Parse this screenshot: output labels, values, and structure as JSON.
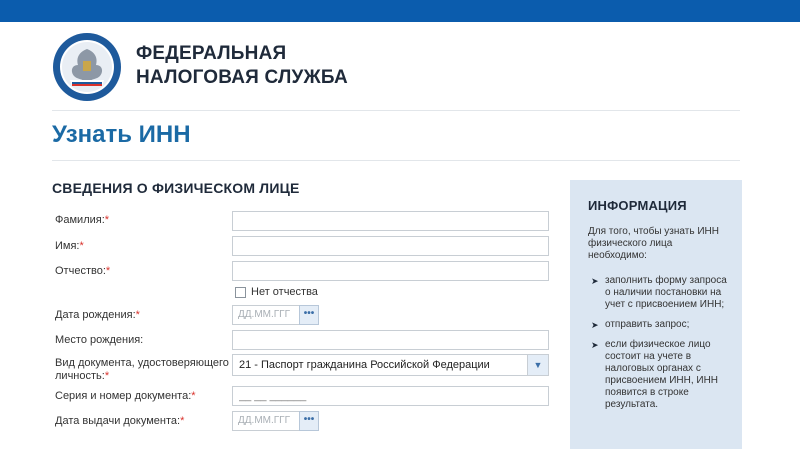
{
  "header": {
    "org_line1": "ФЕДЕРАЛЬНАЯ",
    "org_line2": "НАЛОГОВАЯ СЛУЖБА",
    "emblem_text": "ФЕДЕРАЛЬНАЯ НАЛОГОВАЯ СЛУЖБА",
    "topbar_color": "#0b5cad"
  },
  "page": {
    "title": "Узнать ИНН",
    "title_color": "#1b6aa5"
  },
  "form": {
    "section_title": "СВЕДЕНИЯ О ФИЗИЧЕСКОМ ЛИЦЕ",
    "required_mark": "*",
    "required_color": "#d9312b",
    "fields": {
      "surname": {
        "label": "Фамилия:",
        "value": ""
      },
      "name": {
        "label": "Имя:",
        "value": ""
      },
      "patronymic": {
        "label": "Отчество:",
        "value": ""
      },
      "no_patronymic": {
        "label": "Нет отчества",
        "checked": false
      },
      "birth_date": {
        "label": "Дата рождения:",
        "placeholder": "ДД.ММ.ГГГ",
        "button": "•••"
      },
      "birth_place": {
        "label": "Место рождения:",
        "value": ""
      },
      "doc_type": {
        "label_line1": "Вид документа, удостоверяющего",
        "label_line2": "личность:",
        "selected": "21 - Паспорт гражданина Российской Федерации"
      },
      "doc_number": {
        "label": "Серия и номер документа:",
        "placeholder": "__ __ ______"
      },
      "doc_date": {
        "label": "Дата выдачи документа:",
        "placeholder": "ДД.ММ.ГГГ",
        "button": "•••"
      }
    }
  },
  "info": {
    "title": "ИНФОРМАЦИЯ",
    "intro": "Для того, чтобы узнать ИНН физического лица необходимо:",
    "items": [
      "заполнить форму запроса о наличии постановки на учет с присвоением ИНН;",
      "отправить запрос;",
      "если физическое лицо состоит на учете в налоговых органах с присвоением ИНН, ИНН появится в строке результата."
    ],
    "panel_color": "#dbe6f2"
  }
}
